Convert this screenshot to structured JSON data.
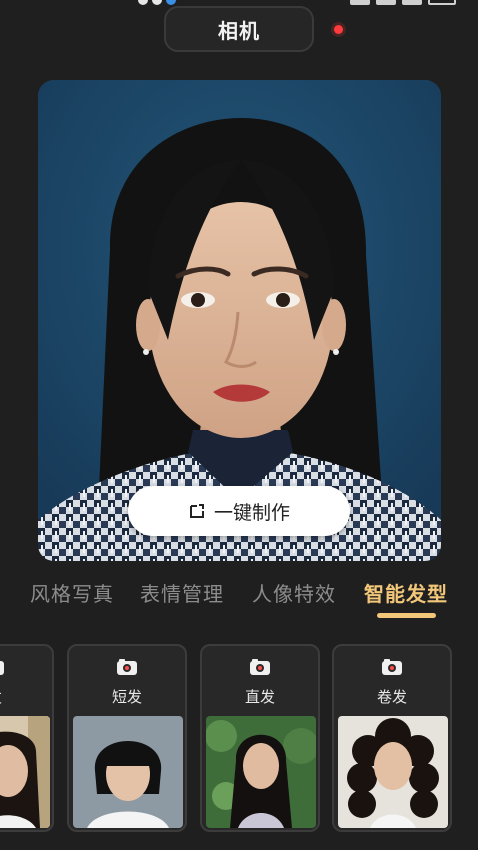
{
  "header": {
    "title": "相机"
  },
  "photo": {
    "subject": "female id-style portrait",
    "background_color": "#1d4668",
    "action_label": "一键制作"
  },
  "tabs": [
    {
      "label": "风格写真",
      "active": false
    },
    {
      "label": "表情管理",
      "active": false
    },
    {
      "label": "人像特效",
      "active": false
    },
    {
      "label": "智能发型",
      "active": true
    }
  ],
  "styles": [
    {
      "label": "长发",
      "icon": "camera-icon"
    },
    {
      "label": "短发",
      "icon": "camera-icon"
    },
    {
      "label": "直发",
      "icon": "camera-icon"
    },
    {
      "label": "卷发",
      "icon": "camera-icon"
    }
  ],
  "colors": {
    "accent": "#f3c77a",
    "record": "#ff3b3b",
    "background": "#1f1f1f"
  }
}
